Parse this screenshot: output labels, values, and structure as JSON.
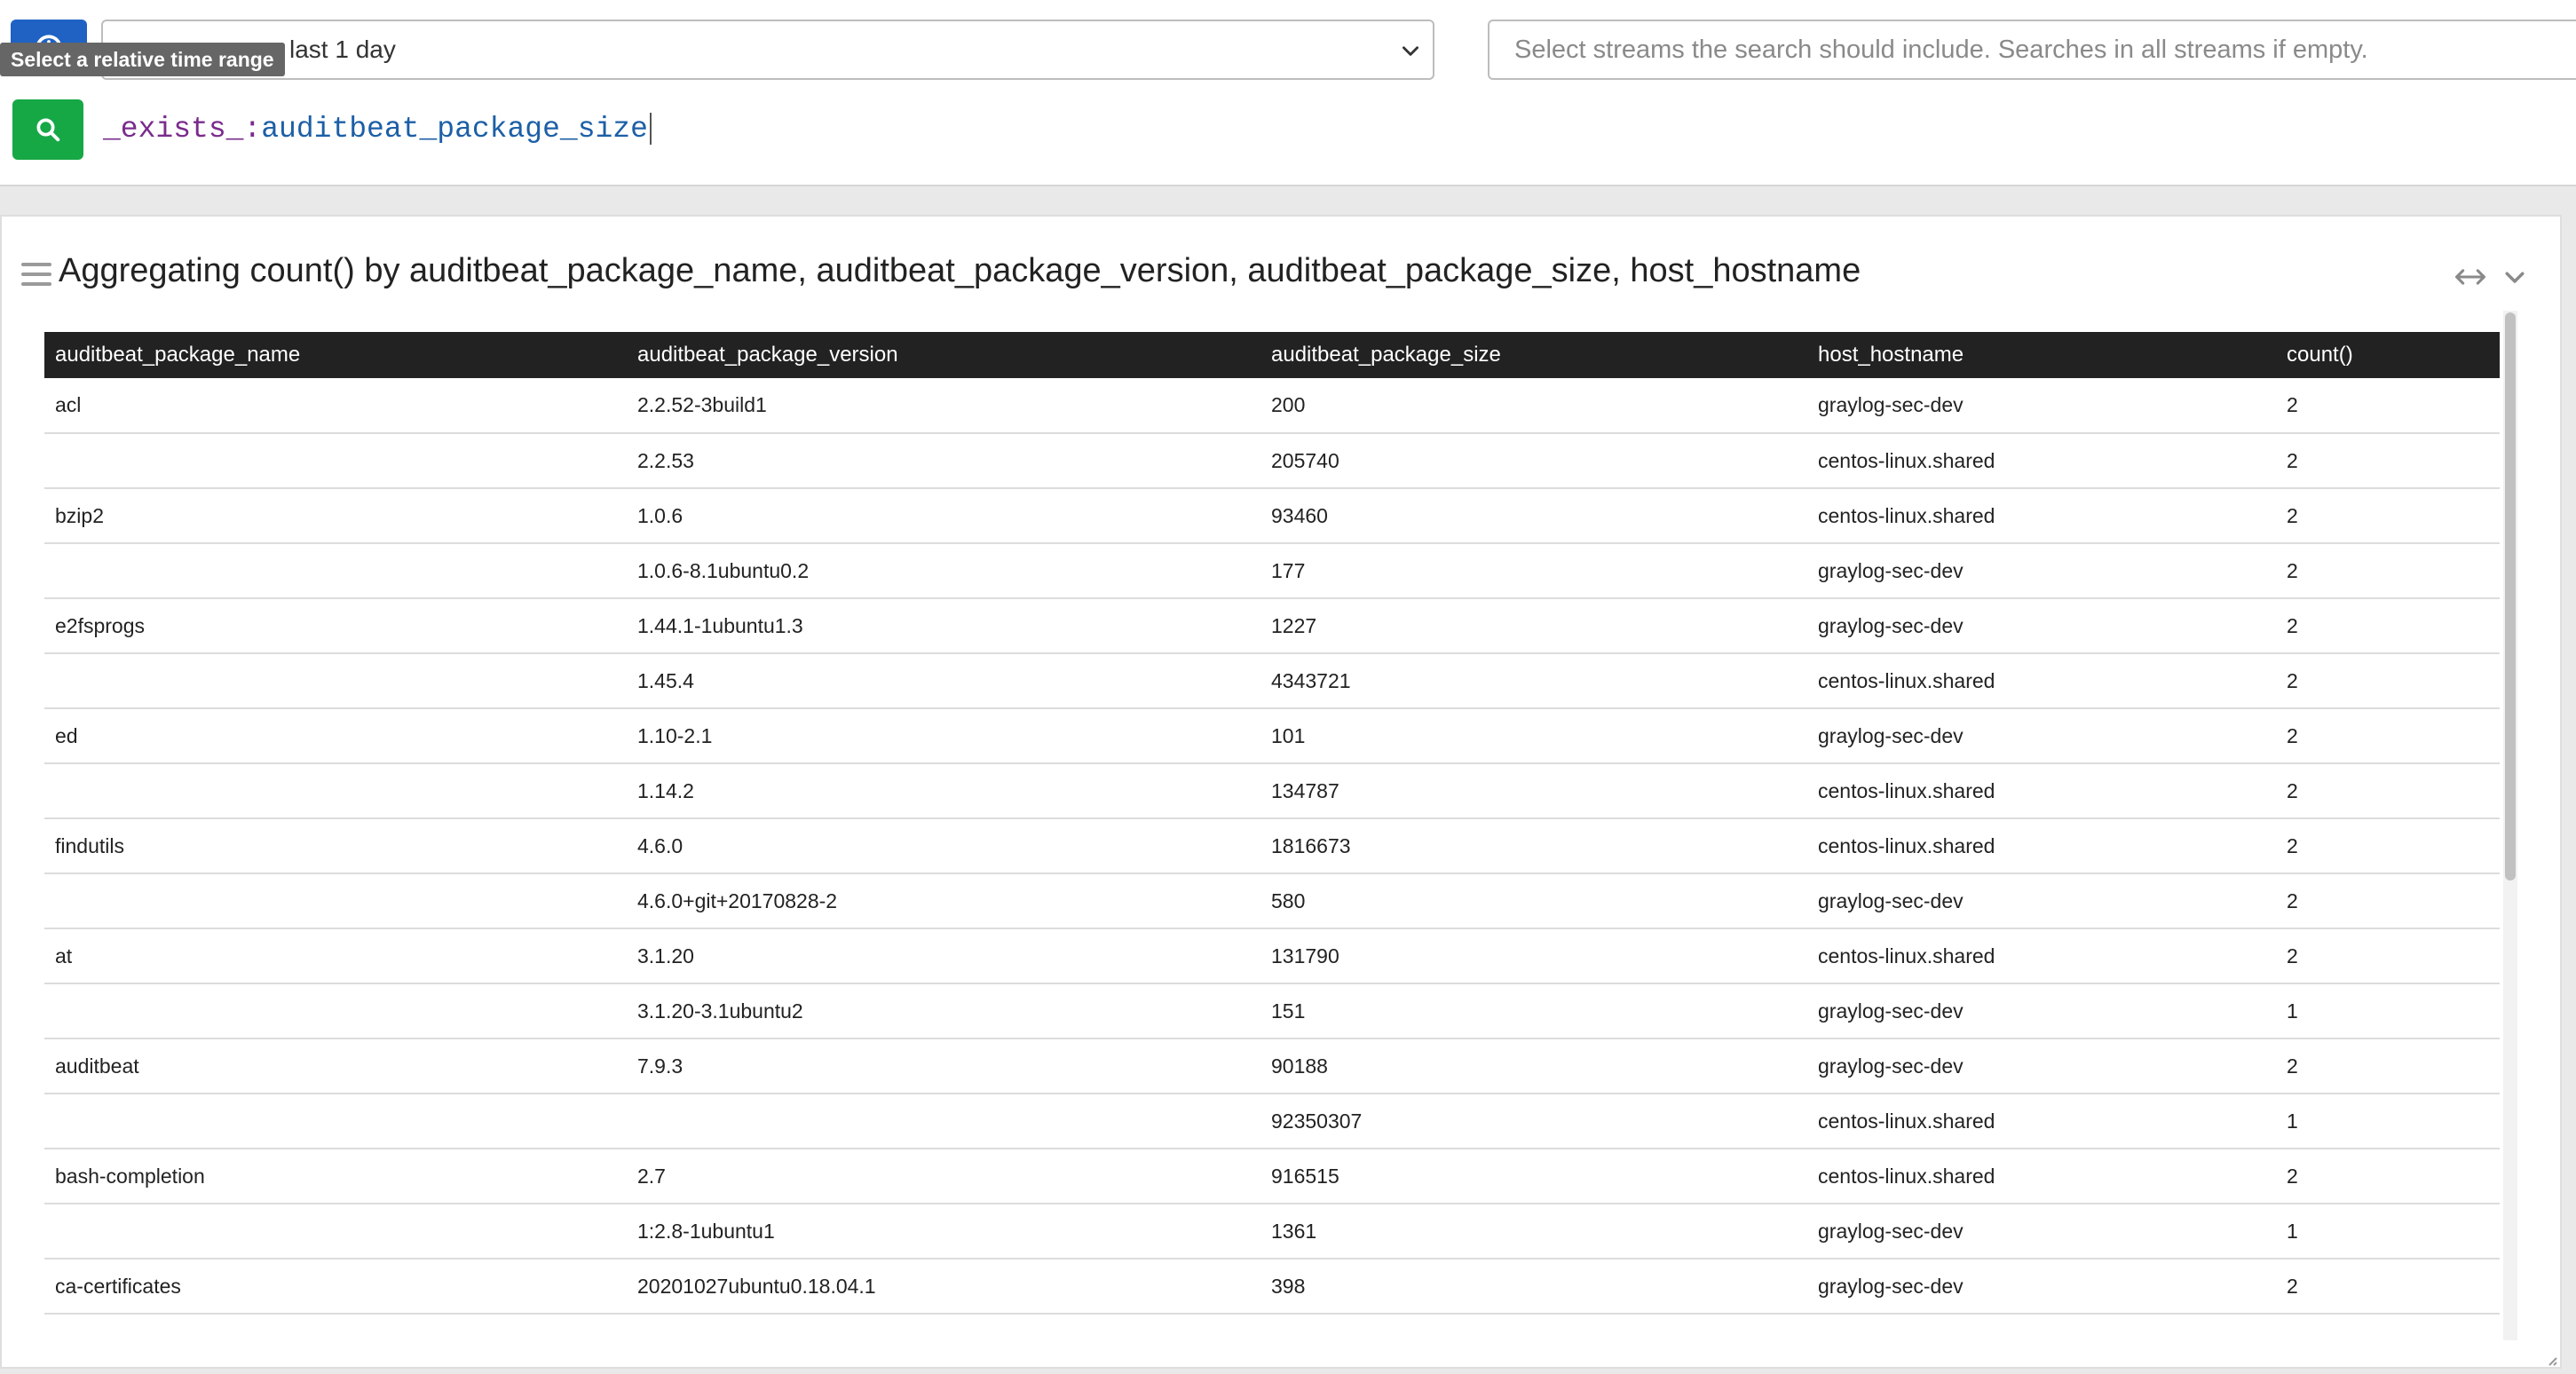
{
  "header": {
    "time_range_value": "last 1 day",
    "time_tooltip": "Select a relative time range",
    "streams_placeholder": "Select streams the search should include. Searches in all streams if empty.",
    "query_prefix": "_exists_:",
    "query_field": "auditbeat_package_size"
  },
  "widget": {
    "title": "Aggregating count() by auditbeat_package_name, auditbeat_package_version, auditbeat_package_size, host_hostname",
    "columns": [
      "auditbeat_package_name",
      "auditbeat_package_version",
      "auditbeat_package_size",
      "host_hostname",
      "count()"
    ],
    "rows": [
      [
        "acl",
        "2.2.52-3build1",
        "200",
        "graylog-sec-dev",
        "2"
      ],
      [
        "",
        "2.2.53",
        "205740",
        "centos-linux.shared",
        "2"
      ],
      [
        "bzip2",
        "1.0.6",
        "93460",
        "centos-linux.shared",
        "2"
      ],
      [
        "",
        "1.0.6-8.1ubuntu0.2",
        "177",
        "graylog-sec-dev",
        "2"
      ],
      [
        "e2fsprogs",
        "1.44.1-1ubuntu1.3",
        "1227",
        "graylog-sec-dev",
        "2"
      ],
      [
        "",
        "1.45.4",
        "4343721",
        "centos-linux.shared",
        "2"
      ],
      [
        "ed",
        "1.10-2.1",
        "101",
        "graylog-sec-dev",
        "2"
      ],
      [
        "",
        "1.14.2",
        "134787",
        "centos-linux.shared",
        "2"
      ],
      [
        "findutils",
        "4.6.0",
        "1816673",
        "centos-linux.shared",
        "2"
      ],
      [
        "",
        "4.6.0+git+20170828-2",
        "580",
        "graylog-sec-dev",
        "2"
      ],
      [
        "at",
        "3.1.20",
        "131790",
        "centos-linux.shared",
        "2"
      ],
      [
        "",
        "3.1.20-3.1ubuntu2",
        "151",
        "graylog-sec-dev",
        "1"
      ],
      [
        "auditbeat",
        "7.9.3",
        "90188",
        "graylog-sec-dev",
        "2"
      ],
      [
        "",
        "",
        "92350307",
        "centos-linux.shared",
        "1"
      ],
      [
        "bash-completion",
        "2.7",
        "916515",
        "centos-linux.shared",
        "2"
      ],
      [
        "",
        "1:2.8-1ubuntu1",
        "1361",
        "graylog-sec-dev",
        "1"
      ],
      [
        "ca-certificates",
        "20201027ubuntu0.18.04.1",
        "398",
        "graylog-sec-dev",
        "2"
      ]
    ]
  },
  "colors": {
    "time_button": "#1f62c4",
    "search_button": "#17a846",
    "table_header": "#222222"
  },
  "icons": {
    "time_button": "clock-icon",
    "search_button": "search-icon",
    "drag_handle": "hamburger-icon",
    "expand": "horizontal-arrows-icon",
    "collapse": "chevron-down-icon"
  }
}
